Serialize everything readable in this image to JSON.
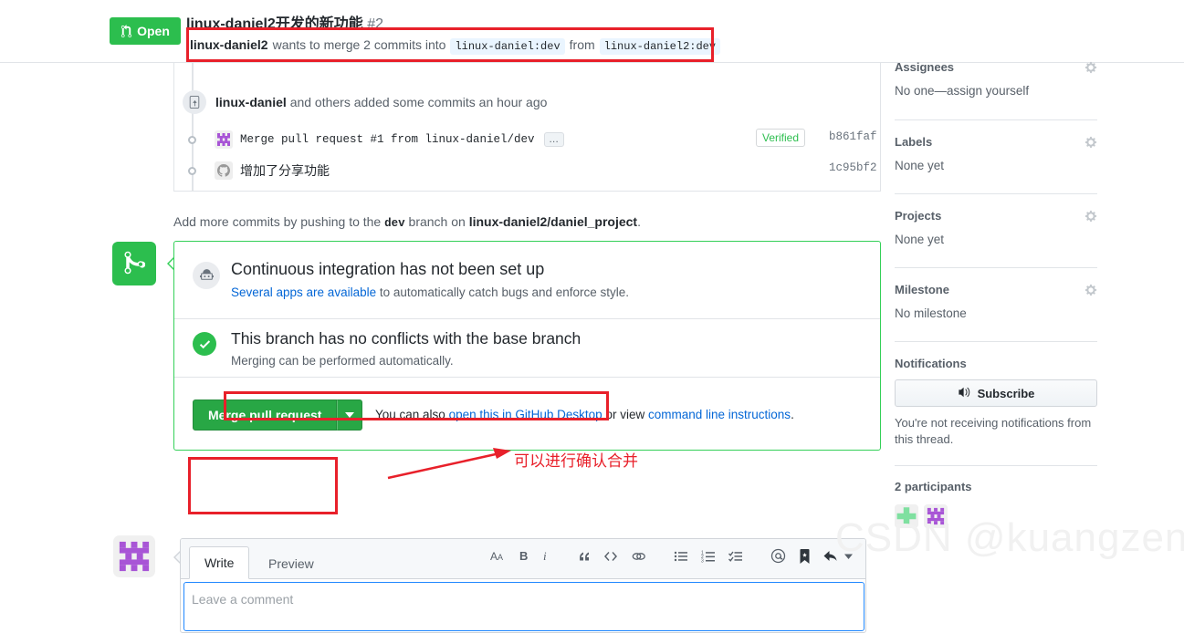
{
  "header": {
    "state_label": "Open",
    "state_color": "#2cbe4e",
    "title": "linux-daniel2开发的新功能",
    "number": "#2",
    "sub_author": "linux-daniel2",
    "sub_text_1": "wants to merge 2 commits into",
    "base_branch": "linux-daniel:dev",
    "sub_text_2": "from",
    "head_branch": "linux-daniel2:dev"
  },
  "commits": {
    "header_author": "linux-daniel",
    "header_rest": "and others added some commits an hour ago",
    "rows": [
      {
        "message": "Merge pull request #1 from linux-daniel/dev",
        "ellipsis": "…",
        "verified": "Verified",
        "sha": "b861faf",
        "avatar": "identicon-purple"
      },
      {
        "message": "增加了分享功能",
        "verified": "",
        "sha": "1c95bf2",
        "avatar": "octocat-gray"
      }
    ]
  },
  "add_more": {
    "prefix": "Add more commits by pushing to the",
    "branch": "dev",
    "middle": "branch on",
    "repo": "linux-daniel2/daniel_project",
    "suffix": "."
  },
  "merge_box": {
    "ci_title": "Continuous integration has not been set up",
    "ci_link": "Several apps are available",
    "ci_rest": "to automatically catch bugs and enforce style.",
    "conflict_title": "This branch has no conflicts with the base branch",
    "conflict_sub": "Merging can be performed automatically.",
    "merge_button": "Merge pull request",
    "help_prefix": "You can also",
    "help_link1": "open this in GitHub Desktop",
    "help_middle": "or view",
    "help_link2": "command line instructions",
    "help_suffix": "."
  },
  "annotation": {
    "text": "可以进行确认合并",
    "color": "#e8202a"
  },
  "comment": {
    "tab_write": "Write",
    "tab_preview": "Preview",
    "placeholder": "Leave a comment",
    "toolbar": [
      "heading-icon",
      "bold-icon",
      "italic-icon",
      "quote-icon",
      "code-icon",
      "link-icon",
      "bulleted-list-icon",
      "numbered-list-icon",
      "task-list-icon",
      "mention-icon",
      "reference-icon",
      "reply-icon"
    ]
  },
  "sidebar": {
    "assignees": {
      "title": "Assignees",
      "value": "No one—assign yourself"
    },
    "labels": {
      "title": "Labels",
      "value": "None yet"
    },
    "projects": {
      "title": "Projects",
      "value": "None yet"
    },
    "milestone": {
      "title": "Milestone",
      "value": "No milestone"
    },
    "notifications": {
      "title": "Notifications",
      "button": "Subscribe",
      "note": "You're not receiving notifications from this thread."
    },
    "participants": {
      "title": "2 participants"
    }
  },
  "watermark": "CSDN @kuangzeng"
}
